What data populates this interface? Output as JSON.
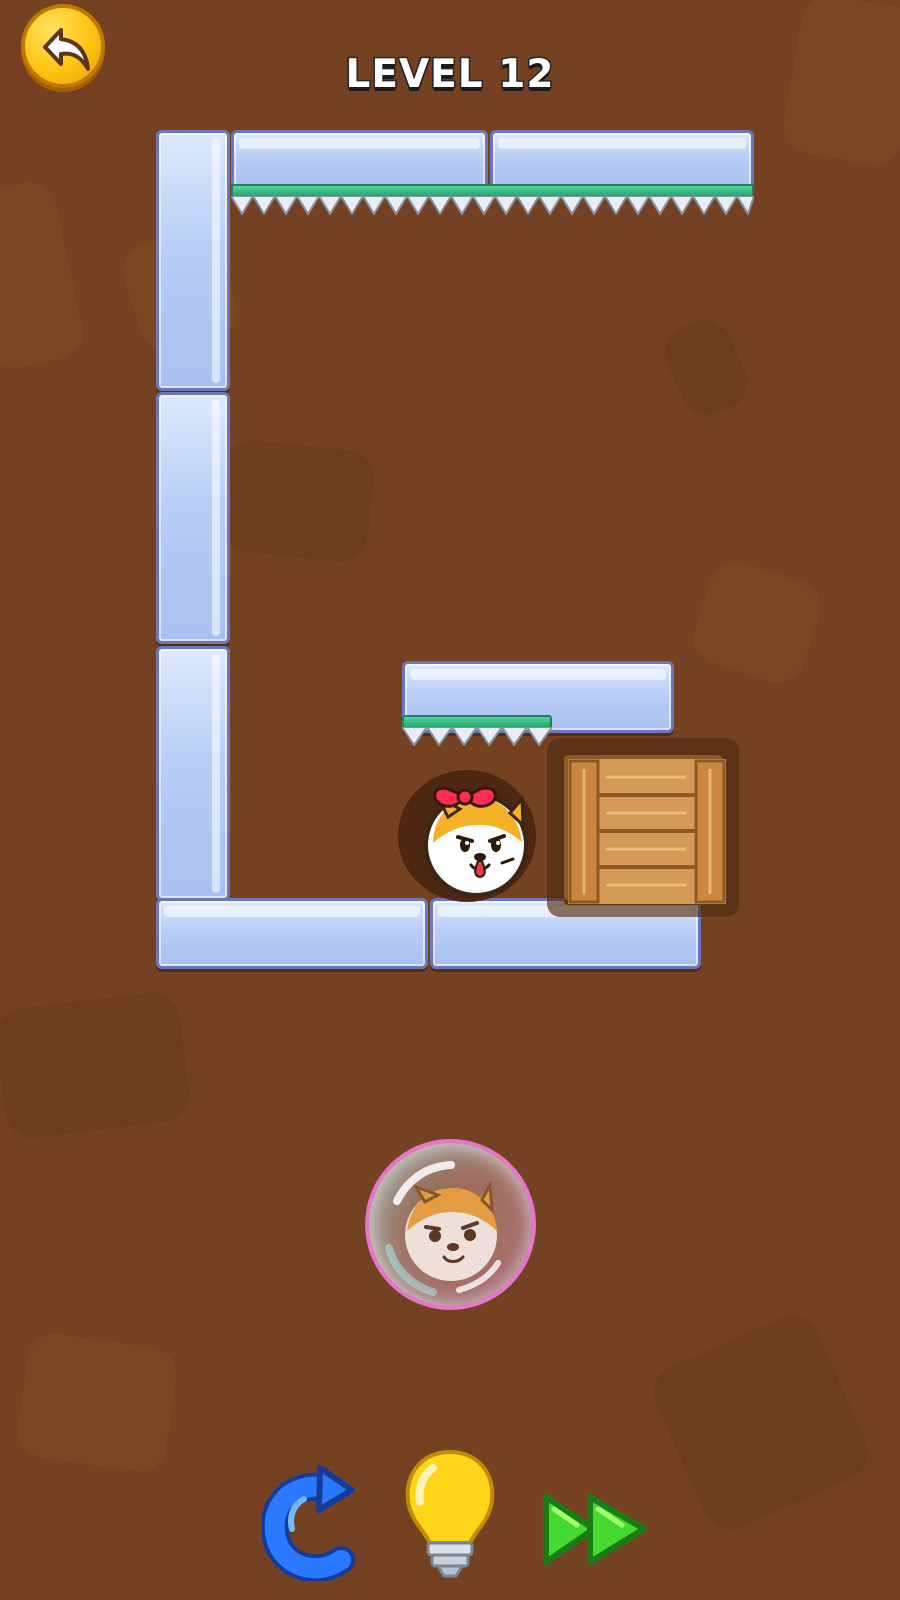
{
  "header": {
    "back_icon": "back-arrow-icon",
    "level_label": "LEVEL 12"
  },
  "game_objects": {
    "player_character": "shiba-dog-with-red-bow",
    "bubble_character": "shiba-dog-in-bubble",
    "crate": "wooden-crate",
    "hazards": "spikes"
  },
  "controls": {
    "restart_icon": "restart-icon",
    "hint_icon": "lightbulb-icon",
    "skip_icon": "fast-forward-icon"
  },
  "colors": {
    "background": "#744222",
    "ice_block": "#b8cef5",
    "green_strip": "#23a46e",
    "gold_button": "#ffc314",
    "hint_bulb": "#ffd51c",
    "restart_blue": "#2a79ff",
    "skip_green": "#46d92f"
  }
}
